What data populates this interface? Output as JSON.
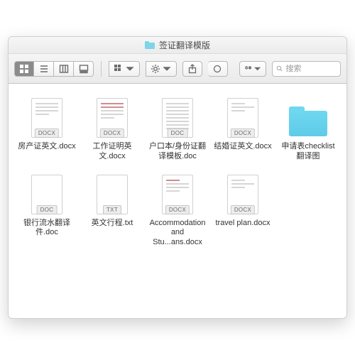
{
  "window": {
    "title": "签证翻译模版"
  },
  "toolbar": {
    "search_placeholder": "搜索"
  },
  "files": [
    {
      "name": "房产证英文.docx",
      "badge": "DOCX",
      "kind": "docx",
      "preview": "plain"
    },
    {
      "name": "工作证明英文.docx",
      "badge": "DOCX",
      "kind": "docx",
      "preview": "red"
    },
    {
      "name": "户口本/身份证翻译模板.doc",
      "badge": "DOC",
      "kind": "doc",
      "preview": "dense"
    },
    {
      "name": "结婚证英文.docx",
      "badge": "DOCX",
      "kind": "docx",
      "preview": "sparse"
    },
    {
      "name": "申请表checklist翻译图",
      "badge": "",
      "kind": "folder",
      "preview": ""
    },
    {
      "name": "银行流水翻译件.doc",
      "badge": "DOC",
      "kind": "doc",
      "preview": "blank"
    },
    {
      "name": "英文行程.txt",
      "badge": "TXT",
      "kind": "txt",
      "preview": "blank"
    },
    {
      "name": "Accommodation and Stu...ans.docx",
      "badge": "DOCX",
      "kind": "docx",
      "preview": "red2"
    },
    {
      "name": "travel plan.docx",
      "badge": "DOCX",
      "kind": "docx",
      "preview": "sparse"
    }
  ]
}
